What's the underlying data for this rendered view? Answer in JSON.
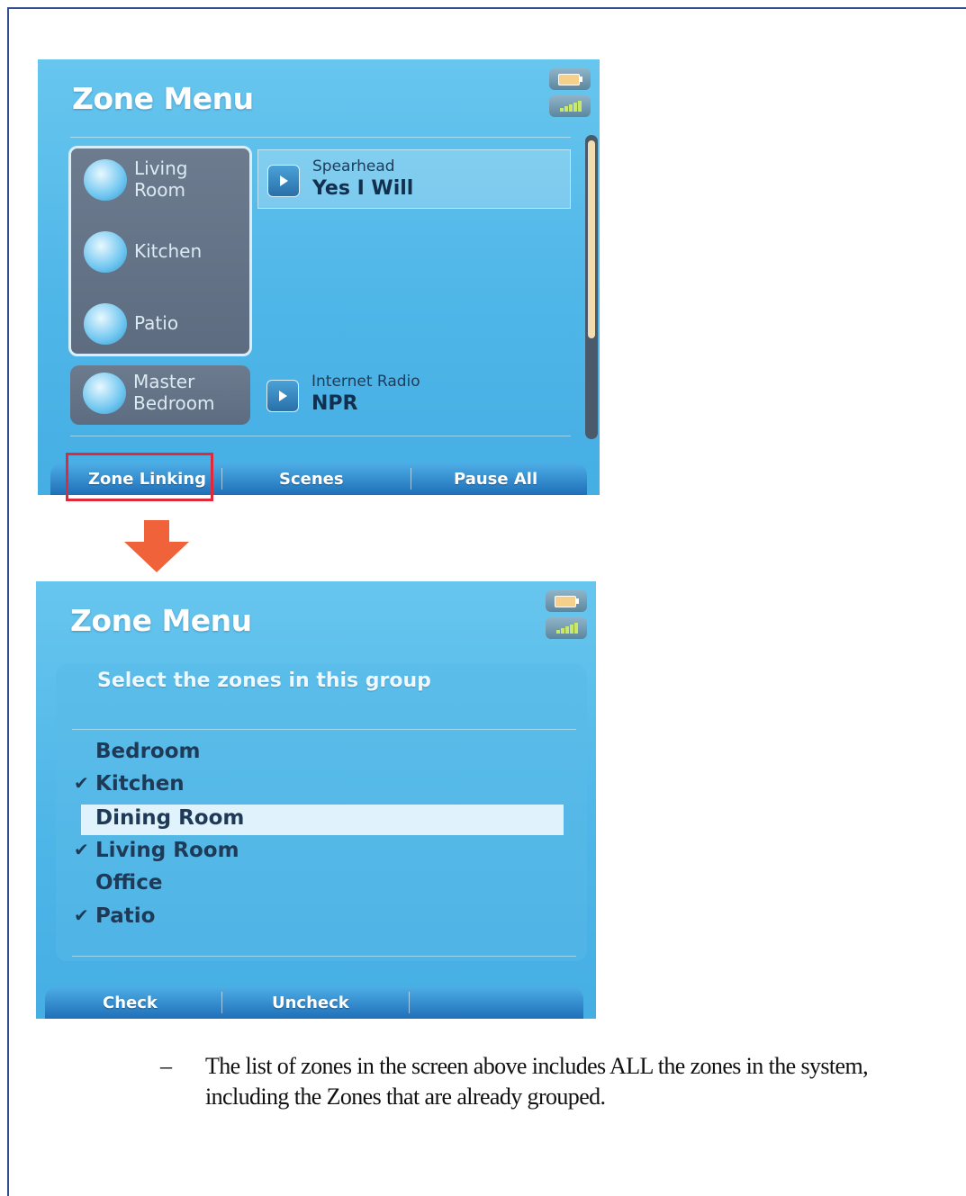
{
  "screen1": {
    "title": "Zone Menu",
    "groups": [
      {
        "zones": [
          {
            "name": "Living\nRoom",
            "icon": "living-room-icon"
          },
          {
            "name": "Kitchen",
            "icon": "kitchen-icon"
          },
          {
            "name": "Patio",
            "icon": "patio-icon"
          }
        ],
        "source": "Spearhead",
        "track": "Yes I Will"
      },
      {
        "zones": [
          {
            "name": "Master\nBedroom",
            "icon": "master-bedroom-icon"
          }
        ],
        "source": "Internet Radio",
        "track": "NPR"
      }
    ],
    "softkeys": [
      "Zone Linking",
      "Scenes",
      "Pause All"
    ]
  },
  "screen2": {
    "title": "Zone Menu",
    "subtitle": "Select the zones in this group",
    "zones": [
      {
        "name": "Bedroom",
        "checked": false,
        "focused": false
      },
      {
        "name": "Kitchen",
        "checked": true,
        "focused": false
      },
      {
        "name": "Dining Room",
        "checked": false,
        "focused": true
      },
      {
        "name": "Living Room",
        "checked": true,
        "focused": false
      },
      {
        "name": "Office",
        "checked": false,
        "focused": false
      },
      {
        "name": "Patio",
        "checked": true,
        "focused": false
      }
    ],
    "checkmark": "✔",
    "softkeys": [
      "Check",
      "Uncheck"
    ]
  },
  "caption": {
    "dash": "–",
    "text": "The list of zones in the screen above includes ALL the zones in the system, including the Zones that are already grouped."
  },
  "colors": {
    "highlight": "#e02a3a",
    "arrow": "#f0633a",
    "screen_bg": "#55b9ea"
  }
}
